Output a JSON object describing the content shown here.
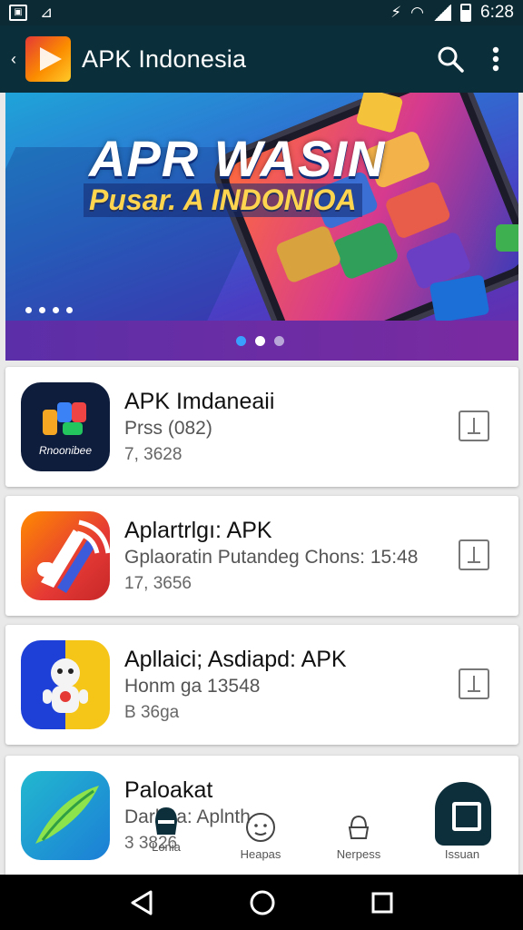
{
  "status_bar": {
    "time": "6:28",
    "left_icons": [
      "image-notification-icon",
      "nfc-icon"
    ],
    "right_icons": [
      "vibrate-icon",
      "wifi-icon",
      "signal-icon",
      "battery-icon"
    ]
  },
  "app_bar": {
    "title": "APK Indonesia",
    "icons": [
      "back-icon",
      "app-logo",
      "search-icon",
      "more-vert-icon"
    ]
  },
  "banner": {
    "title": "APR WASIN",
    "subtitle_a": "Pusar.",
    "subtitle_b": "A INDONIOA",
    "pager_active_index": 1,
    "pager_count": 3
  },
  "apps": [
    {
      "name": "APK Imdaneaii",
      "subtitle": "Prss (082)",
      "count": "7, 3628",
      "icon_text": "Rnoonibee"
    },
    {
      "name": "Aplartrlgı: APK",
      "subtitle": "Gplaoratin Putandeg Chons: 15:48",
      "count": "17, 3656"
    },
    {
      "name": "Apllaici; Asdiapd: APK",
      "subtitle": "Honm ga 13548",
      "count": "B 36ga"
    },
    {
      "name": "Paloakat",
      "subtitle": "Darbha: Aplnth",
      "count": "3 3826"
    }
  ],
  "tabs": [
    {
      "label": "Lonia",
      "icon": "home-icon"
    },
    {
      "label": "Heapas",
      "icon": "face-icon"
    },
    {
      "label": "Nerpess",
      "icon": "ice-cream-icon"
    },
    {
      "label": "Issuan",
      "icon": "square-icon"
    }
  ],
  "colors": {
    "appbar": "#0b2f3a",
    "accent": "#0d2f3b",
    "card": "#ffffff",
    "background": "#e9e9e9"
  }
}
